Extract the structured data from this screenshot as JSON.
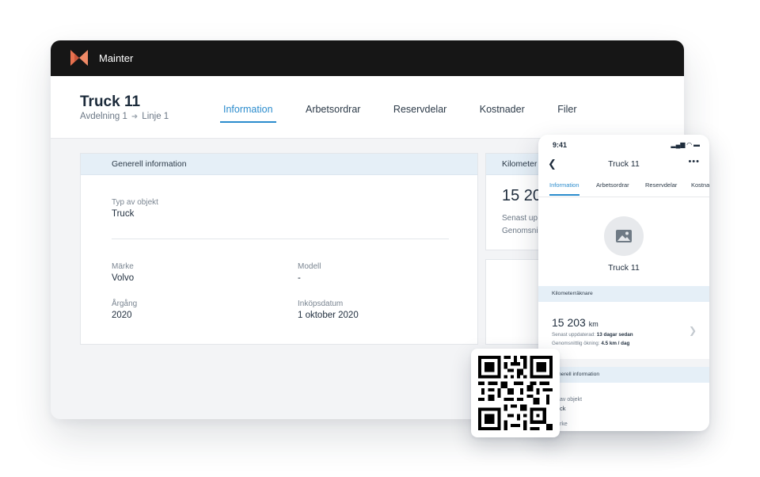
{
  "app": {
    "name": "Mainter",
    "brand_color": "#e8714f",
    "logo_icon": "mainter-logo"
  },
  "page": {
    "title": "Truck 11",
    "breadcrumb": {
      "department": "Avdelning 1",
      "line": "Linje 1"
    },
    "tabs": [
      {
        "label": "Information",
        "active": true
      },
      {
        "label": "Arbetsordrar",
        "active": false
      },
      {
        "label": "Reservdelar",
        "active": false
      },
      {
        "label": "Kostnader",
        "active": false
      },
      {
        "label": "Filer",
        "active": false
      }
    ]
  },
  "general_info": {
    "heading": "Generell information",
    "type": {
      "label": "Typ av objekt",
      "value": "Truck"
    },
    "brand": {
      "label": "Märke",
      "value": "Volvo"
    },
    "model": {
      "label": "Modell",
      "value": "-"
    },
    "year": {
      "label": "Årgång",
      "value": "2020"
    },
    "purchase_date": {
      "label": "Inköpsdatum",
      "value": "1 oktober 2020"
    }
  },
  "odometer_card": {
    "heading": "Kilometer",
    "value": "15 20",
    "line1": "Senast up",
    "line2": "Genomsni"
  },
  "mobile": {
    "time": "9:41",
    "status": "▂▄▆ ◠ ▬",
    "back_icon": "chevron-left-icon",
    "title": "Truck 11",
    "more": "•••",
    "tabs": [
      {
        "label": "Information",
        "active": true
      },
      {
        "label": "Arbetsordrar",
        "active": false
      },
      {
        "label": "Reservdelar",
        "active": false
      },
      {
        "label": "Kostna",
        "active": false
      }
    ],
    "image_icon": "image-placeholder-icon",
    "object_name": "Truck 11",
    "odometer": {
      "heading": "Kilometerräknare",
      "value": "15 203",
      "unit": "km",
      "updated_label": "Senast uppdaterad:",
      "updated_value": "13 dagar sedan",
      "avg_label": "Genomsnittlig ökning:",
      "avg_value": "4.5 km / dag"
    },
    "general": {
      "heading": "nerell information",
      "type_label": "av objekt",
      "type_value": "ck",
      "brand_label": "rke"
    }
  },
  "qr": {
    "icon": "qr-code-icon"
  }
}
